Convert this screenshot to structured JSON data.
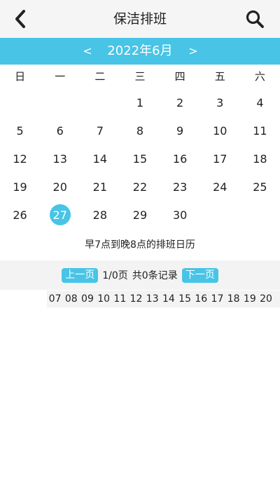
{
  "header": {
    "title": "保洁排班",
    "back_icon": "chevron-left-icon",
    "search_icon": "search-icon"
  },
  "month_bar": {
    "prev": "<",
    "next": ">",
    "label": "2022年6月",
    "color": "#47c4e6"
  },
  "calendar": {
    "weekdays": [
      "日",
      "一",
      "二",
      "三",
      "四",
      "五",
      "六"
    ],
    "weeks": [
      [
        "",
        "",
        "",
        "1",
        "2",
        "3",
        "4"
      ],
      [
        "5",
        "6",
        "7",
        "8",
        "9",
        "10",
        "11"
      ],
      [
        "12",
        "13",
        "14",
        "15",
        "16",
        "17",
        "18"
      ],
      [
        "19",
        "20",
        "21",
        "22",
        "23",
        "24",
        "25"
      ],
      [
        "26",
        "27",
        "28",
        "29",
        "30",
        "",
        ""
      ]
    ],
    "selected_day": "27"
  },
  "caption": "早7点到晚8点的排班日历",
  "pager": {
    "prev_label": "上一页",
    "page_info": "1/0页",
    "total_info": "共0条记录",
    "next_label": "下一页"
  },
  "hours": [
    "07",
    "08",
    "09",
    "10",
    "11",
    "12",
    "13",
    "14",
    "15",
    "16",
    "17",
    "18",
    "19",
    "20"
  ]
}
